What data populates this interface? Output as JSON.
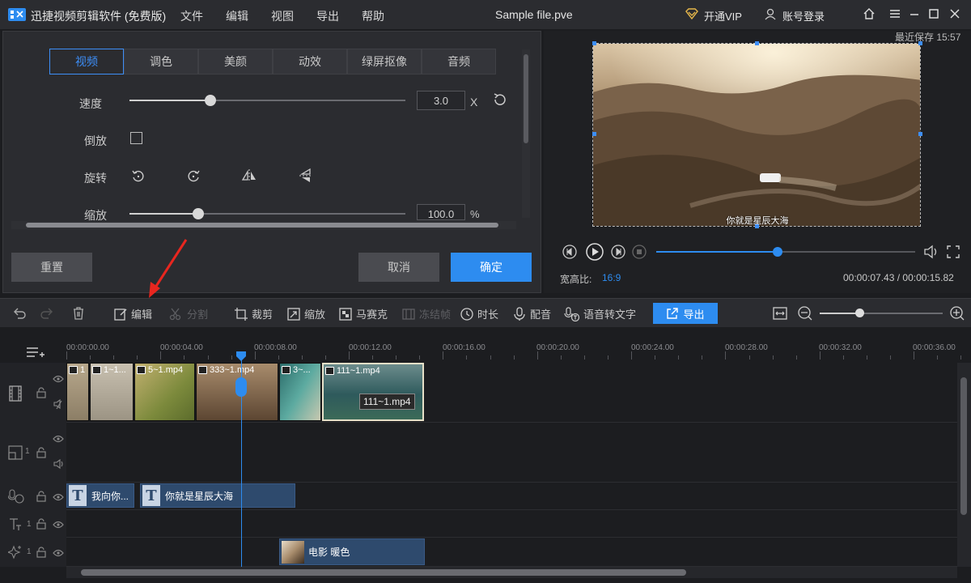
{
  "app": {
    "name": "迅捷视频剪辑软件 (免费版)",
    "menu": [
      "文件",
      "编辑",
      "视图",
      "导出",
      "帮助"
    ],
    "file_name": "Sample file.pve",
    "vip_label": "开通VIP",
    "login_label": "账号登录"
  },
  "props": {
    "tabs": [
      "视频",
      "调色",
      "美颜",
      "动效",
      "绿屏抠像",
      "音频"
    ],
    "active_tab": "视频",
    "speed_label": "速度",
    "speed_value": "3.0",
    "speed_unit": "X",
    "reverse_label": "倒放",
    "rotate_label": "旋转",
    "scale_label": "缩放",
    "scale_value": "100.0",
    "scale_unit": "%",
    "reset_label": "重置",
    "cancel_label": "取消",
    "ok_label": "确定"
  },
  "preview": {
    "last_saved": "最近保存 15:57",
    "subtitle": "你就是星辰大海",
    "aspect_label": "宽高比:",
    "aspect_value": "16:9",
    "time": "00:00:07.43 / 00:00:15.82",
    "progress": 0.47
  },
  "toolbar": {
    "edit": "编辑",
    "split": "分割",
    "crop": "裁剪",
    "zoom": "缩放",
    "mosaic": "马赛克",
    "freeze": "冻结帧",
    "duration": "时长",
    "dub": "配音",
    "speech_to_text": "语音转文字",
    "export": "导出"
  },
  "timeline": {
    "ruler": [
      "00:00:00.00",
      "00:00:04.00",
      "00:00:08.00",
      "00:00:12.00",
      "00:00:16.00",
      "00:00:20.00",
      "00:00:24.00",
      "00:00:28.00",
      "00:00:32.00",
      "00:00:36.00"
    ],
    "clips": [
      {
        "label": "1"
      },
      {
        "label": "1~1..."
      },
      {
        "label": "5~1.mp4"
      },
      {
        "label": "333~1.mp4"
      },
      {
        "label": "3~..."
      },
      {
        "label": "111~1.mp4",
        "tooltip": "111~1.mp4"
      }
    ],
    "text_clips": [
      {
        "badge": "T",
        "label": "我向你..."
      },
      {
        "badge": "T",
        "label": "你就是星辰大海"
      }
    ],
    "filter_clip": "电影 暖色",
    "track_numbers": [
      "1",
      "1",
      "1"
    ]
  },
  "colors": {
    "accent": "#2d8cf0",
    "background": "#1c1d20",
    "panel": "#2b2c30"
  }
}
